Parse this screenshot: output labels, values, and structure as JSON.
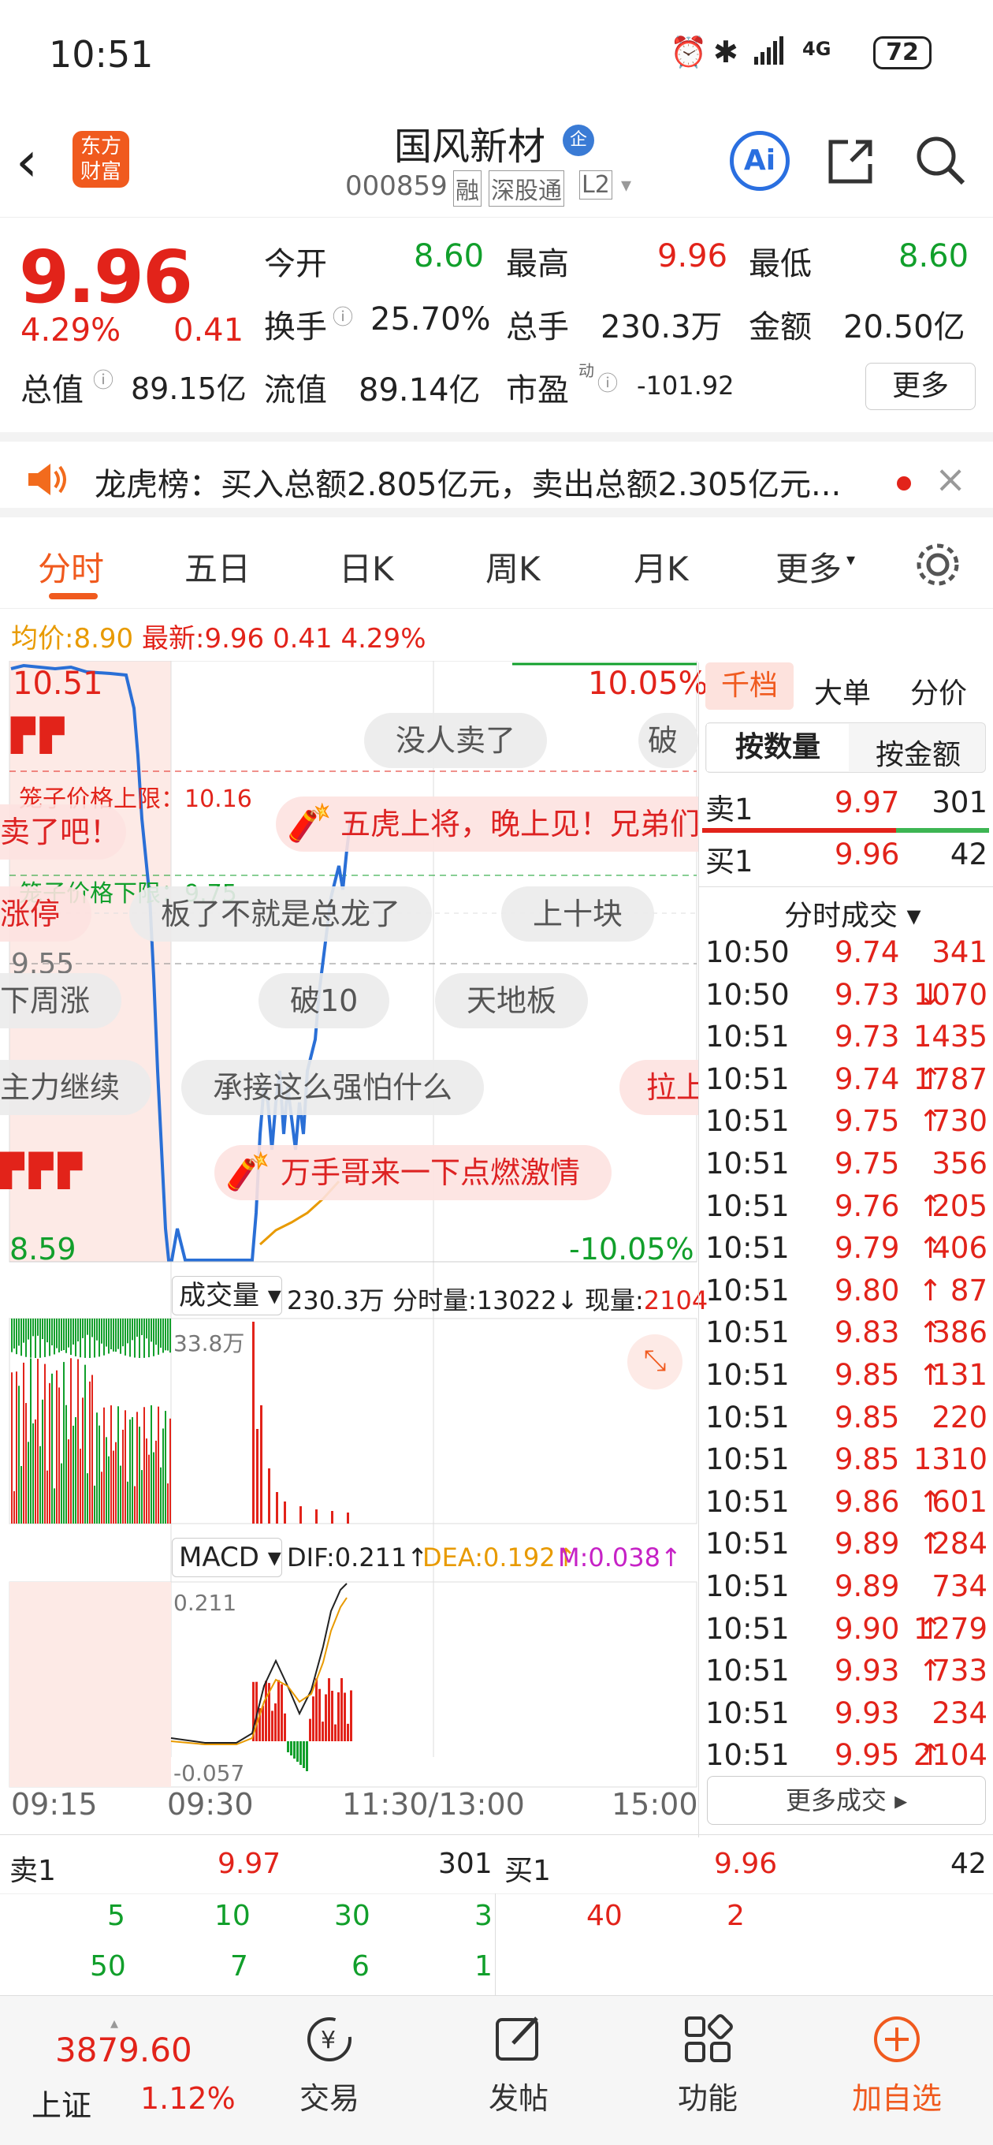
{
  "status": {
    "time": "10:51",
    "battery": "72",
    "net": "4G"
  },
  "header": {
    "title": "国风新材",
    "title_badge": "企",
    "code": "000859",
    "tags": [
      "融",
      "深股通",
      "L2"
    ],
    "logo_line1": "东方",
    "logo_line2": "财富",
    "ai_label": "Ai"
  },
  "quote": {
    "price": "9.96",
    "pct": "4.29%",
    "chg": "0.41",
    "fields": [
      {
        "label": "今开",
        "value": "8.60",
        "color": "green"
      },
      {
        "label": "最高",
        "value": "9.96",
        "color": "red"
      },
      {
        "label": "最低",
        "value": "8.60",
        "color": "green"
      },
      {
        "label": "换手",
        "value": "25.70%",
        "color": "dark"
      },
      {
        "label": "总手",
        "value": "230.3万",
        "color": "dark"
      },
      {
        "label": "金额",
        "value": "20.50亿",
        "color": "dark"
      },
      {
        "label": "流值",
        "value": "89.14亿",
        "color": "dark"
      }
    ],
    "total_label": "总值",
    "total_value": "89.15亿",
    "pe_label": "市盈",
    "pe_sup": "动",
    "pe_value": "-101.92",
    "more": "更多"
  },
  "news": {
    "text": "龙虎榜：买入总额2.805亿元，卖出总额2.305亿元..."
  },
  "tabs": [
    "分时",
    "五日",
    "日K",
    "周K",
    "月K",
    "更多"
  ],
  "summary": {
    "avg_label": "均价:",
    "avg": "8.90",
    "latest_label": "最新:",
    "latest": "9.96",
    "chg": "0.41",
    "pct": "4.29%"
  },
  "chart": {
    "top_price": "10.51",
    "bottom_price": "8.59",
    "top_pct": "10.05%",
    "bottom_pct": "-10.05%",
    "mid_price": "9.55",
    "cage_upper": "笼子价格上限：10.16",
    "cage_lower": "笼子价格下限：9.75",
    "times": [
      "09:15",
      "09:30",
      "11:30/13:00",
      "15:00"
    ]
  },
  "barrage": [
    "没人卖了",
    "破",
    "卖了吧！",
    "五虎上将，晚上见！兄弟们",
    "涨停",
    "板了不就是总龙了",
    "上十块",
    "下周涨",
    "破10",
    "天地板",
    "主力继续",
    "承接这么强怕什么",
    "拉上",
    "万手哥来一下点燃激情"
  ],
  "volume": {
    "label": "成交量",
    "total": "230.3万",
    "fen_label": "分时量:",
    "fen": "13022↓",
    "xian_label": "现量:",
    "xian": "2104",
    "max": "33.8万"
  },
  "macd": {
    "label": "MACD",
    "dif": "DIF:0.211↑",
    "dea": "DEA:0.192↑",
    "m": "M:0.038↑",
    "top": "0.211",
    "bottom": "-0.057"
  },
  "side": {
    "tabs": [
      "千档",
      "大单",
      "分价"
    ],
    "sub": [
      "按数量",
      "按金额"
    ],
    "sell1_label": "卖1",
    "sell1_price": "9.97",
    "sell1_vol": "301",
    "buy1_label": "买1",
    "buy1_price": "9.96",
    "buy1_vol": "42",
    "trades_title": "分时成交",
    "more_trades": "更多成交",
    "trades": [
      [
        "10:50",
        "9.74",
        "",
        "341"
      ],
      [
        "10:50",
        "9.73",
        "↓",
        "1070"
      ],
      [
        "10:51",
        "9.73",
        "",
        "1435"
      ],
      [
        "10:51",
        "9.74",
        "↑",
        "1787"
      ],
      [
        "10:51",
        "9.75",
        "↑",
        "730"
      ],
      [
        "10:51",
        "9.75",
        "",
        "356"
      ],
      [
        "10:51",
        "9.76",
        "↑",
        "205"
      ],
      [
        "10:51",
        "9.79",
        "↑",
        "406"
      ],
      [
        "10:51",
        "9.80",
        "↑",
        "87"
      ],
      [
        "10:51",
        "9.83",
        "↑",
        "386"
      ],
      [
        "10:51",
        "9.85",
        "↑",
        "131"
      ],
      [
        "10:51",
        "9.85",
        "",
        "220"
      ],
      [
        "10:51",
        "9.85",
        "",
        "1310"
      ],
      [
        "10:51",
        "9.86",
        "↑",
        "601"
      ],
      [
        "10:51",
        "9.89",
        "↑",
        "284"
      ],
      [
        "10:51",
        "9.89",
        "",
        "734"
      ],
      [
        "10:51",
        "9.90",
        "↑",
        "1279"
      ],
      [
        "10:51",
        "9.93",
        "↑",
        "733"
      ],
      [
        "10:51",
        "9.93",
        "",
        "234"
      ],
      [
        "10:51",
        "9.95",
        "↑",
        "2104"
      ]
    ]
  },
  "orderbook": {
    "sell_label": "卖1",
    "sell_price": "9.97",
    "sell_vol": "301",
    "buy_label": "买1",
    "buy_price": "9.96",
    "buy_vol": "42",
    "sell_q1": [
      "5",
      "10",
      "30",
      "3"
    ],
    "sell_q2": [
      "50",
      "7",
      "6",
      "1"
    ],
    "buy_q": [
      "40",
      "2"
    ]
  },
  "bottom": {
    "index_value": "3879.60",
    "index_name": "上证",
    "index_pct": "1.12%",
    "items": [
      "交易",
      "发帖",
      "功能",
      "加自选"
    ]
  }
}
